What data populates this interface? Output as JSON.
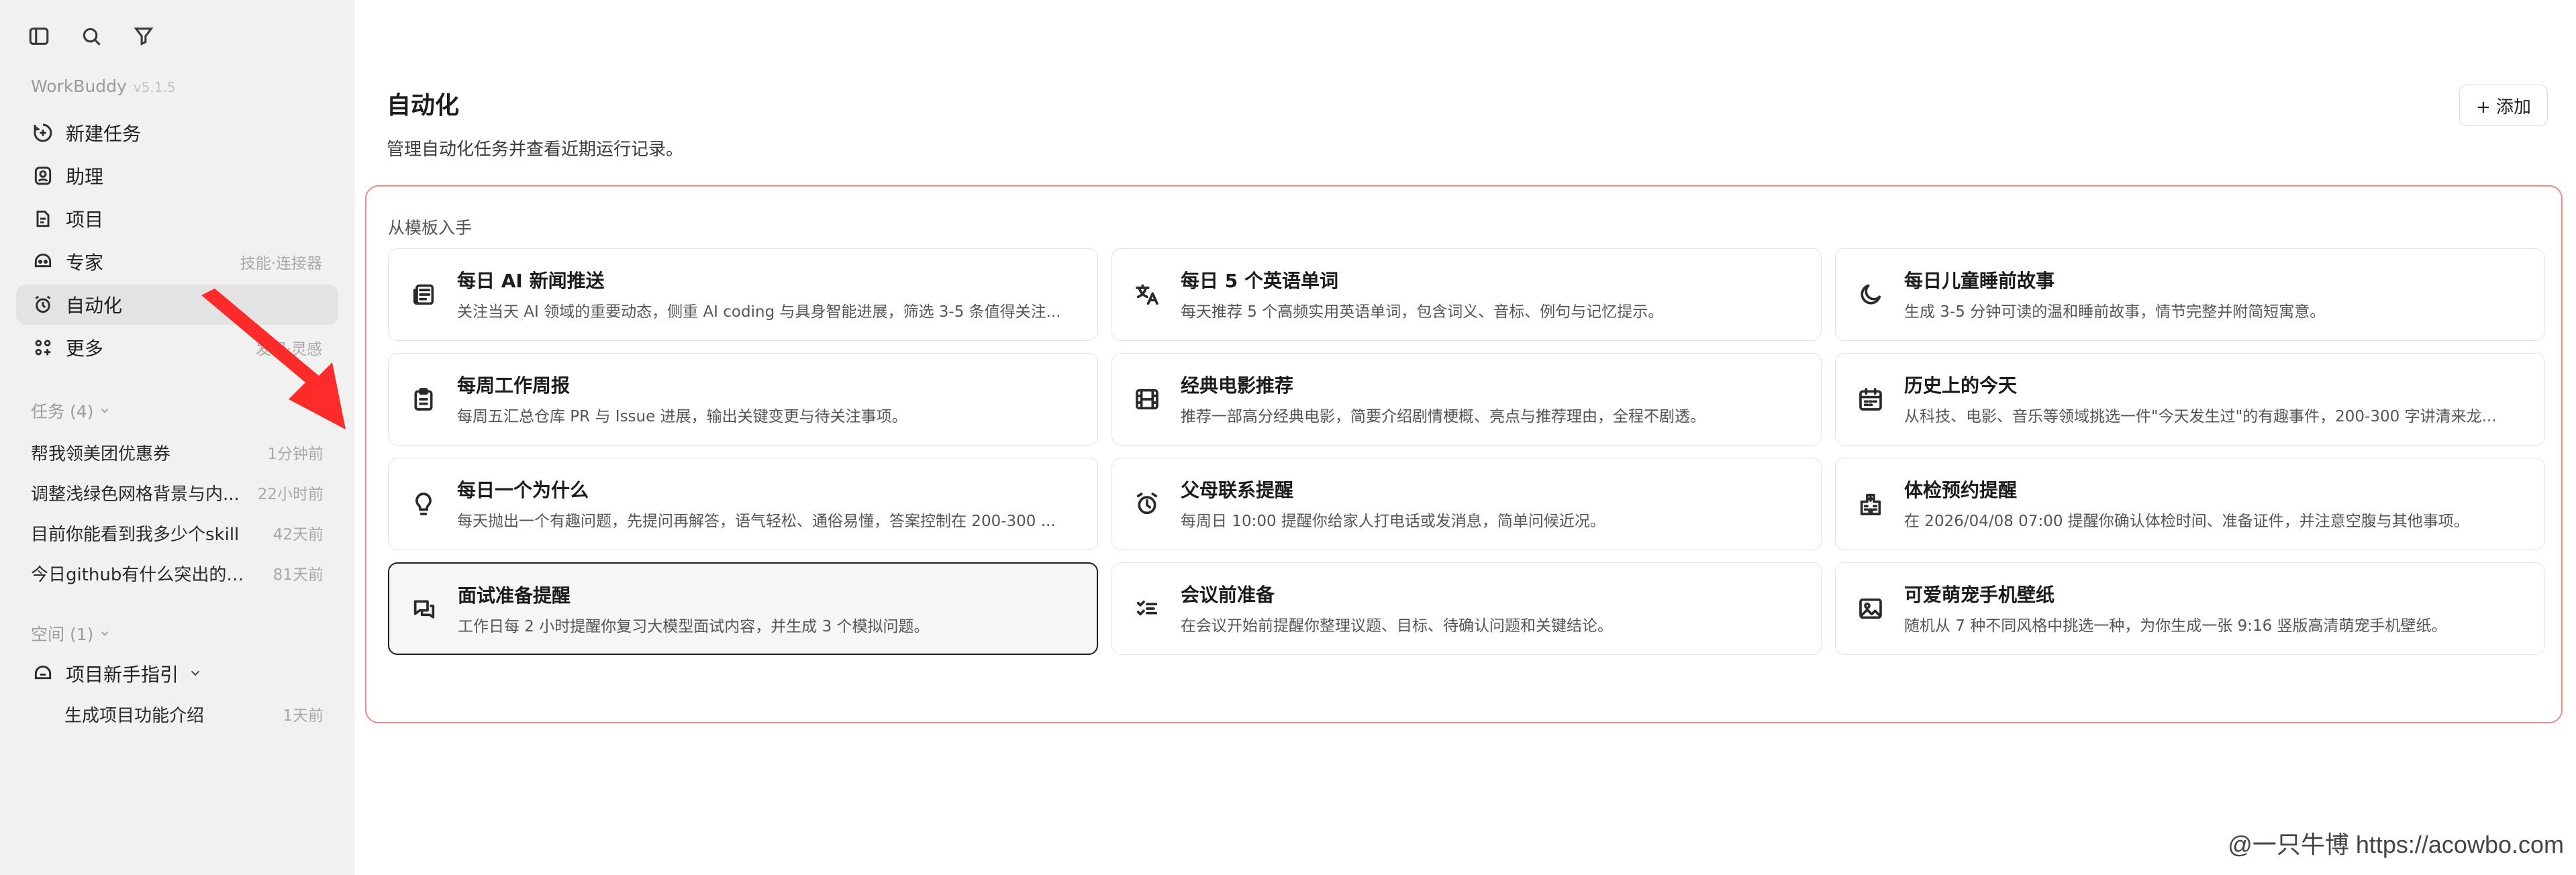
{
  "sidebar": {
    "brand": "WorkBuddy",
    "version": "v5.1.5",
    "top_icons": [
      "sidebar-toggle-icon",
      "search-icon",
      "filter-icon"
    ],
    "nav": [
      {
        "label": "新建任务",
        "icon": "plus-circle-icon",
        "sub": ""
      },
      {
        "label": "助理",
        "icon": "assistant-icon",
        "sub": ""
      },
      {
        "label": "项目",
        "icon": "project-icon",
        "sub": ""
      },
      {
        "label": "专家",
        "icon": "expert-icon",
        "sub": "技能·连接器"
      },
      {
        "label": "自动化",
        "icon": "alarm-clock-icon",
        "sub": "",
        "active": true
      },
      {
        "label": "更多",
        "icon": "grid-plus-icon",
        "sub": "发现·灵感"
      }
    ],
    "tasks_title": "任务 (4)",
    "tasks": [
      {
        "label": "帮我领美团优惠券",
        "time": "1分钟前"
      },
      {
        "label": "调整浅绿色网格背景与内...",
        "time": "22小时前"
      },
      {
        "label": "目前你能看到我多少个skill",
        "time": "42天前"
      },
      {
        "label": "今日github有什么突出的项...",
        "time": "81天前"
      }
    ],
    "space_title": "空间 (1)",
    "space": {
      "label": "项目新手指引",
      "child_label": "生成项目功能介绍",
      "child_time": "1天前"
    }
  },
  "main": {
    "title": "自动化",
    "description": "管理自动化任务并查看近期运行记录。",
    "add_button": "+ 添加",
    "templates_title": "从模板入手",
    "templates": [
      {
        "title": "每日 AI 新闻推送",
        "desc": "关注当天 AI 领域的重要动态，侧重 AI coding 与具身智能进展，筛选 3-5 条值得关注...",
        "icon": "news-icon"
      },
      {
        "title": "每日 5 个英语单词",
        "desc": "每天推荐 5 个高频实用英语单词，包含词义、音标、例句与记忆提示。",
        "icon": "translate-icon"
      },
      {
        "title": "每日儿童睡前故事",
        "desc": "生成 3-5 分钟可读的温和睡前故事，情节完整并附简短寓意。",
        "icon": "moon-icon"
      },
      {
        "title": "每周工作周报",
        "desc": "每周五汇总仓库 PR 与 Issue 进展，输出关键变更与待关注事项。",
        "icon": "clipboard-icon"
      },
      {
        "title": "经典电影推荐",
        "desc": "推荐一部高分经典电影，简要介绍剧情梗概、亮点与推荐理由，全程不剧透。",
        "icon": "film-icon"
      },
      {
        "title": "历史上的今天",
        "desc": "从科技、电影、音乐等领域挑选一件\"今天发生过\"的有趣事件，200-300 字讲清来龙...",
        "icon": "calendar-icon"
      },
      {
        "title": "每日一个为什么",
        "desc": "每天抛出一个有趣问题，先提问再解答，语气轻松、通俗易懂，答案控制在 200-300 ...",
        "icon": "lightbulb-icon"
      },
      {
        "title": "父母联系提醒",
        "desc": "每周日 10:00 提醒你给家人打电话或发消息，简单问候近况。",
        "icon": "alarm-icon"
      },
      {
        "title": "体检预约提醒",
        "desc": "在 2026/04/08 07:00 提醒你确认体检时间、准备证件，并注意空腹与其他事项。",
        "icon": "hospital-icon"
      },
      {
        "title": "面试准备提醒",
        "desc": "工作日每 2 小时提醒你复习大模型面试内容，并生成 3 个模拟问题。",
        "icon": "chat-icon",
        "selected": true
      },
      {
        "title": "会议前准备",
        "desc": "在会议开始前提醒你整理议题、目标、待确认问题和关键结论。",
        "icon": "checklist-icon"
      },
      {
        "title": "可爱萌宠手机壁纸",
        "desc": "随机从 7 种不同风格中挑选一种，为你生成一张 9:16 竖版高清萌宠手机壁纸。",
        "icon": "image-icon"
      }
    ]
  },
  "watermark": "@一只牛博 https://acowbo.com",
  "colors": {
    "highlight_border": "#f08a8a",
    "annotation_arrow": "#ff2a2a",
    "sidebar_bg": "#f1f1f1"
  }
}
